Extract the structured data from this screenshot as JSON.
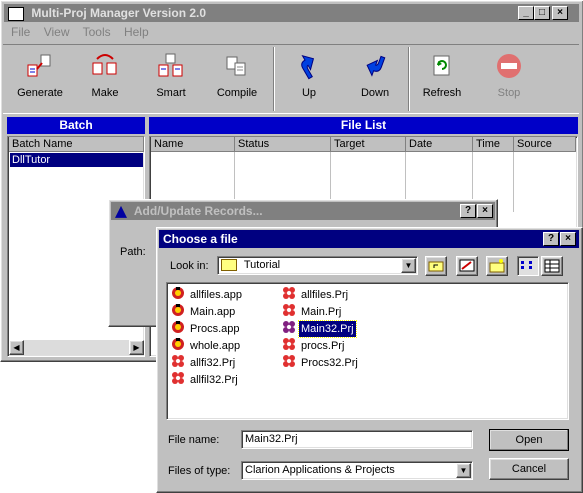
{
  "main_window": {
    "title": "Multi-Proj Manager Version 2.0",
    "menu": [
      "File",
      "View",
      "Tools",
      "Help"
    ],
    "toolbar": [
      {
        "label": "Generate",
        "icon": "generate-icon"
      },
      {
        "label": "Make",
        "icon": "make-icon"
      },
      {
        "label": "Smart",
        "icon": "smart-icon"
      },
      {
        "label": "Compile",
        "icon": "compile-icon"
      },
      {
        "label": "Up",
        "icon": "arrow-up-icon"
      },
      {
        "label": "Down",
        "icon": "arrow-down-icon"
      },
      {
        "label": "Refresh",
        "icon": "refresh-icon"
      },
      {
        "label": "Stop",
        "icon": "stop-icon"
      }
    ],
    "batch_panel": {
      "header": "Batch",
      "column": "Batch Name",
      "items": [
        "DllTutor"
      ]
    },
    "file_panel": {
      "header": "File List",
      "columns": [
        "Name",
        "Status",
        "Target",
        "Date",
        "Time",
        "Source"
      ]
    }
  },
  "add_update_dialog": {
    "title": "Add/Update Records...",
    "path_label": "Path:"
  },
  "file_dialog": {
    "title": "Choose a file",
    "look_in_label": "Look in:",
    "look_in_value": "Tutorial",
    "files_col1": [
      "allfiles.app",
      "Main.app",
      "Procs.app",
      "whole.app",
      "allfi32.Prj",
      "allfil32.Prj"
    ],
    "files_col2": [
      "allfiles.Prj",
      "Main.Prj",
      "Main32.Prj",
      "procs.Prj",
      "Procs32.Prj"
    ],
    "selected_file": "Main32.Prj",
    "file_name_label": "File name:",
    "file_name_value": "Main32.Prj",
    "file_type_label": "Files of type:",
    "file_type_value": "Clarion Applications & Projects",
    "open_label": "Open",
    "cancel_label": "Cancel"
  },
  "colors": {
    "active_title": "#000080",
    "panel_header": "#0000c8",
    "face": "#c0c0c0"
  }
}
